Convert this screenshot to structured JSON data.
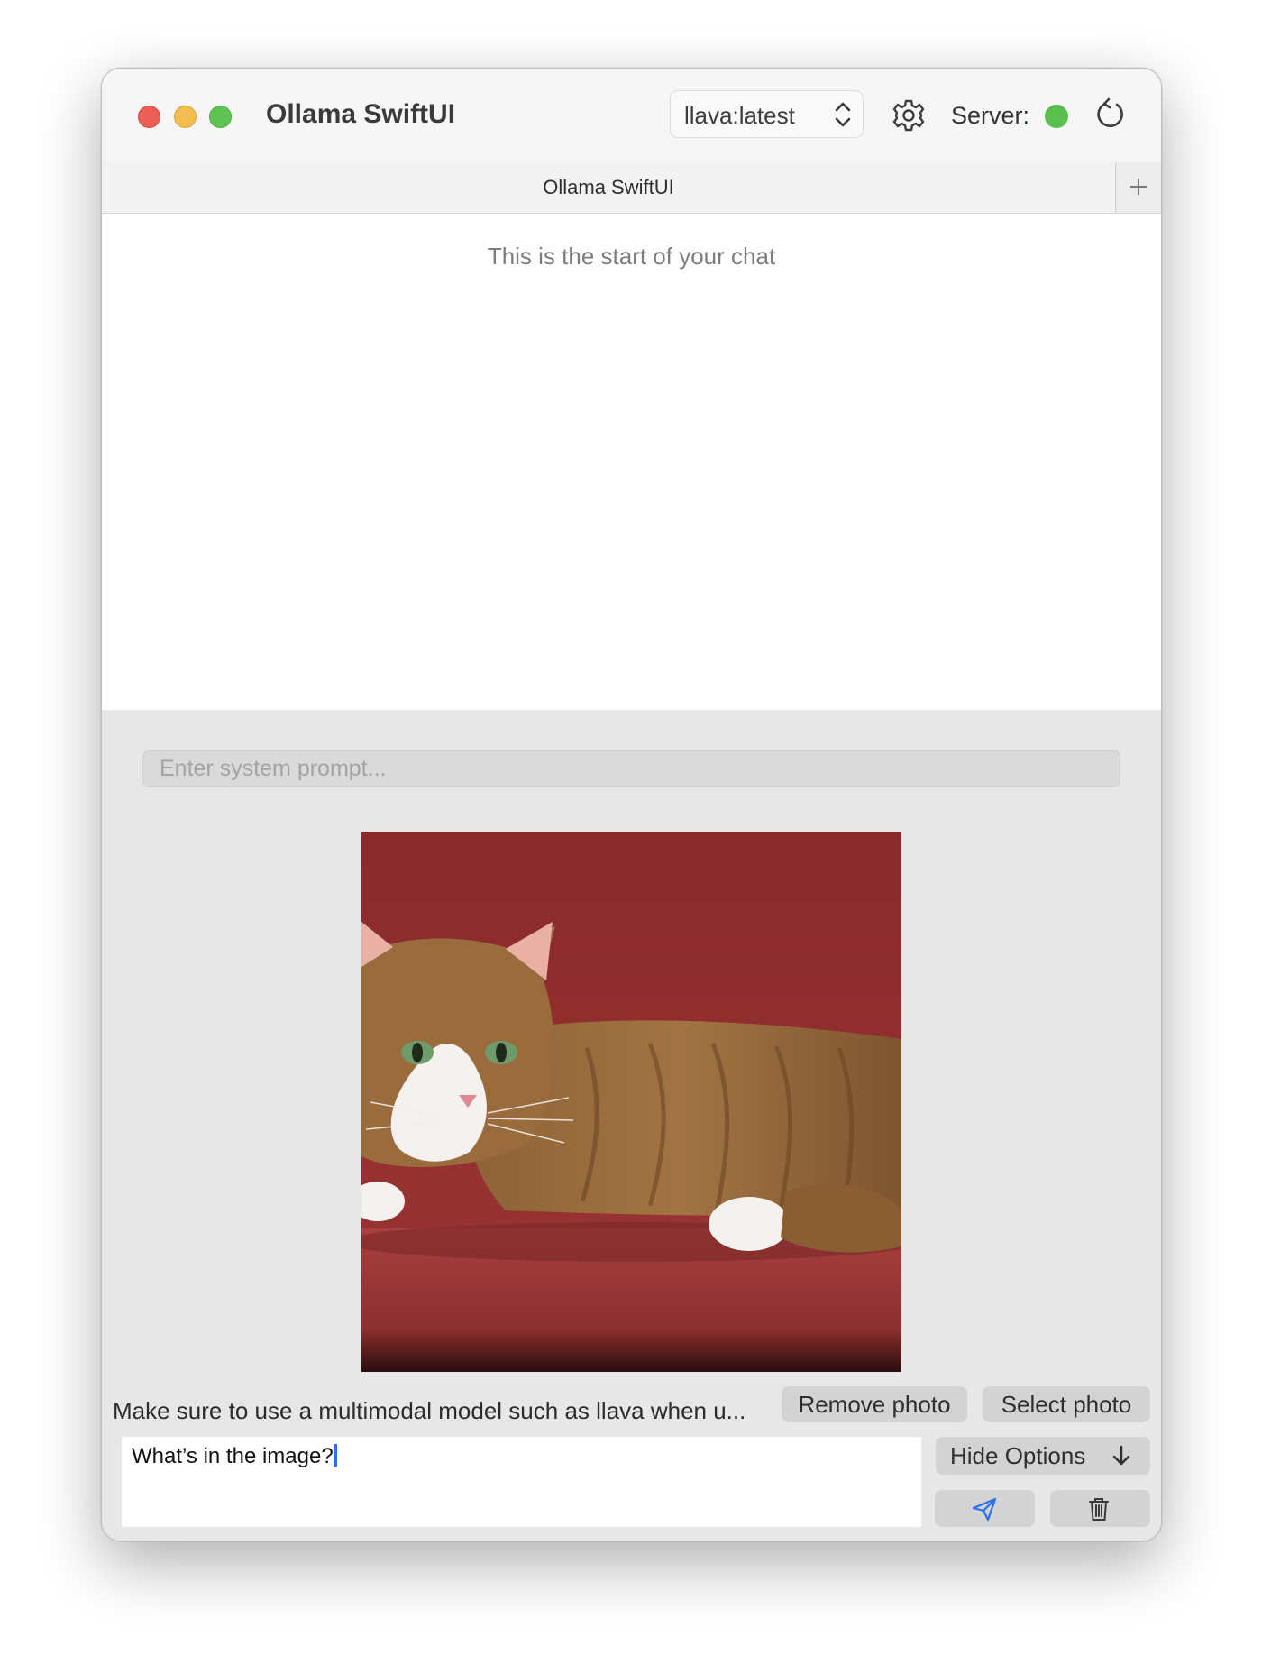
{
  "window": {
    "title": "Ollama SwiftUI"
  },
  "toolbar": {
    "model": "llava:latest",
    "server_label": "Server:",
    "server_status_color": "#5abf4f"
  },
  "tabs": [
    {
      "label": "Ollama SwiftUI"
    }
  ],
  "chat": {
    "empty_text": "This is the start of your chat"
  },
  "options": {
    "system_prompt_placeholder": "Enter system prompt...",
    "photo_subject": "cat lying on red cushion",
    "multimodal_hint": "Make sure to use a multimodal model such as llava when u...",
    "remove_photo_label": "Remove photo",
    "select_photo_label": "Select photo",
    "message_value": "What’s in the image?",
    "hide_options_label": "Hide Options"
  },
  "icons": {
    "settings": "gear-icon",
    "refresh": "refresh-icon",
    "new_tab": "plus-icon",
    "send": "paper-plane-icon",
    "delete": "trash-icon",
    "hide": "arrow-down-icon"
  },
  "colors": {
    "accent": "#2a6ff0",
    "close": "#ec5f57",
    "minimize": "#f4bd4f",
    "maximize": "#5fc454"
  }
}
